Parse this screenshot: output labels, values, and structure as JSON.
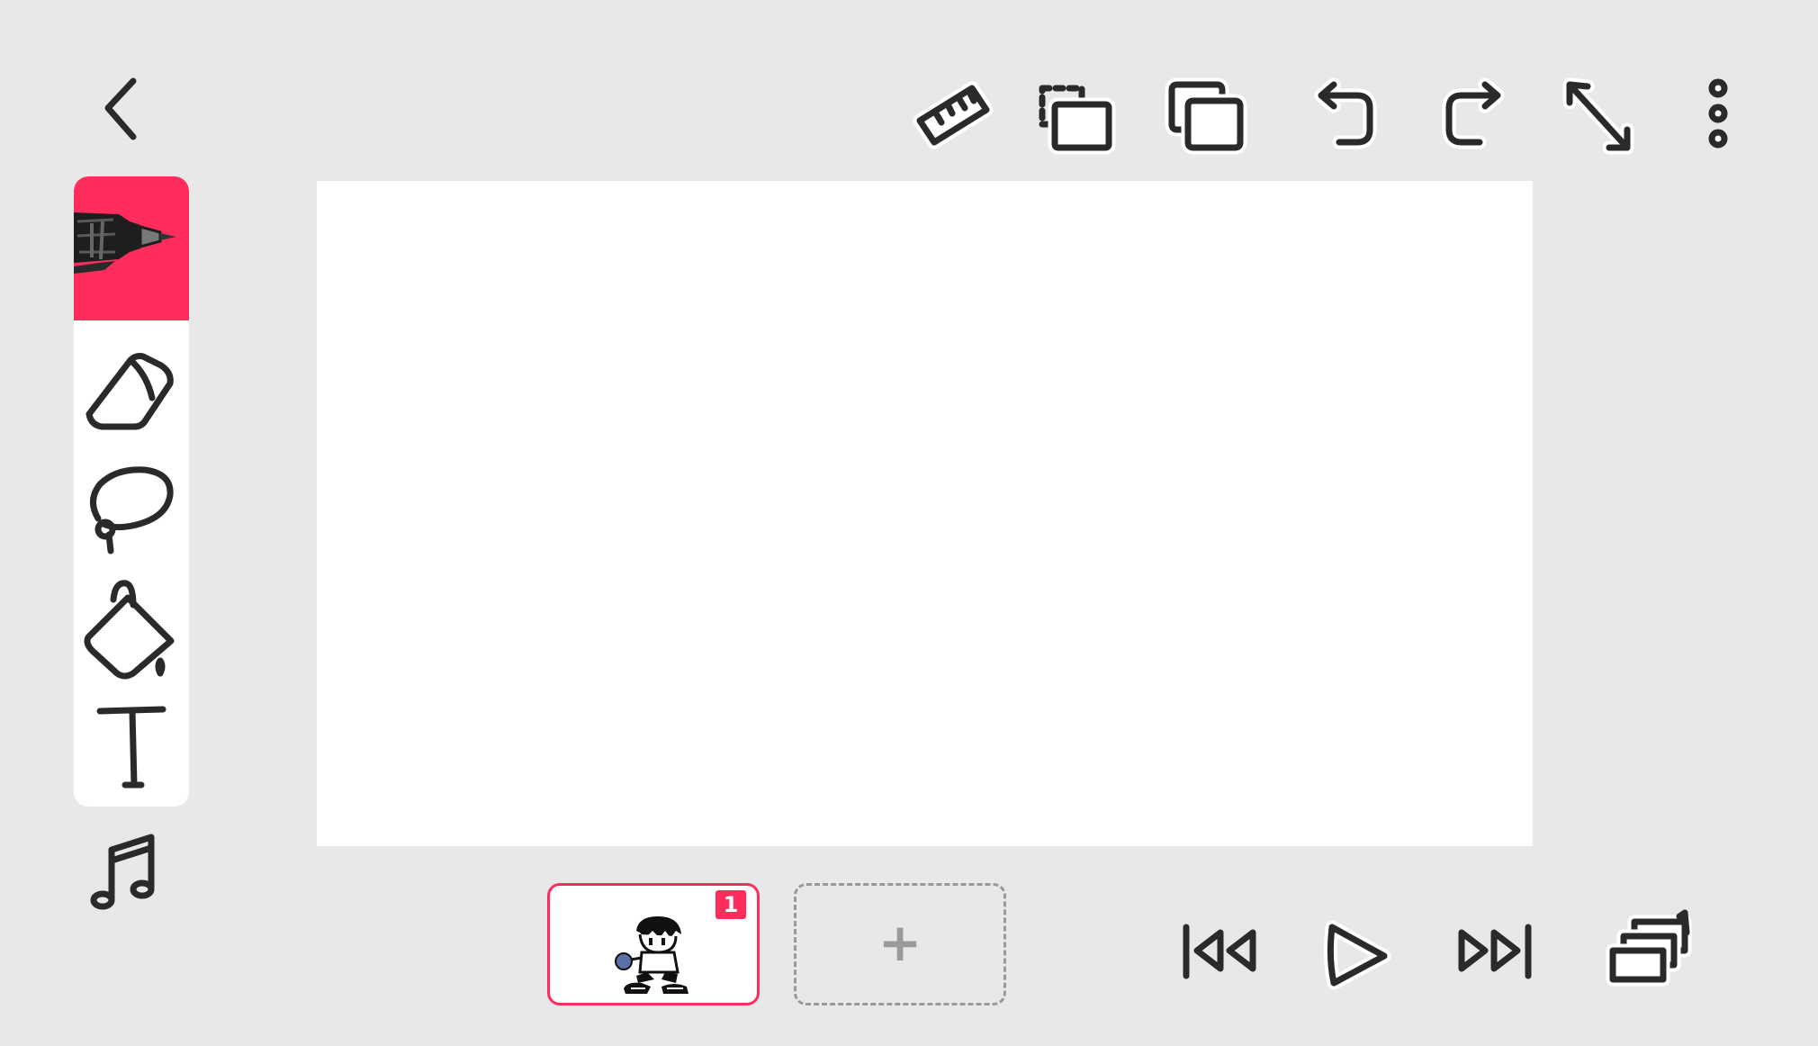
{
  "colors": {
    "background": "#e8e8e8",
    "accent": "#ff2d5e",
    "canvas": "#ffffff",
    "icon_stroke": "#2a2a2a"
  },
  "header": {
    "back_icon": "chevron-left-icon",
    "actions": [
      {
        "name": "ruler",
        "icon": "ruler-icon"
      },
      {
        "name": "select-paste",
        "icon": "select-paste-icon"
      },
      {
        "name": "copy",
        "icon": "copy-icon"
      },
      {
        "name": "undo",
        "icon": "undo-icon"
      },
      {
        "name": "redo",
        "icon": "redo-icon"
      },
      {
        "name": "fullscreen",
        "icon": "resize-diagonal-icon"
      },
      {
        "name": "more",
        "icon": "more-vertical-icon"
      }
    ]
  },
  "toolbar": {
    "active_tool": "pen",
    "tools": [
      {
        "name": "pen",
        "icon": "pen-icon"
      },
      {
        "name": "eraser",
        "icon": "eraser-icon"
      },
      {
        "name": "lasso",
        "icon": "lasso-icon"
      },
      {
        "name": "fill",
        "icon": "paint-bucket-icon"
      },
      {
        "name": "text",
        "icon": "text-icon"
      }
    ],
    "music_icon": "music-note-icon"
  },
  "timeline": {
    "frames": [
      {
        "number": "1",
        "thumbnail": "character-drawing"
      }
    ],
    "add_frame_label": "+"
  },
  "playback": {
    "controls": [
      "skip-to-start-icon",
      "play-icon",
      "skip-to-end-icon",
      "onion-layers-icon"
    ],
    "onion_count": "1"
  }
}
